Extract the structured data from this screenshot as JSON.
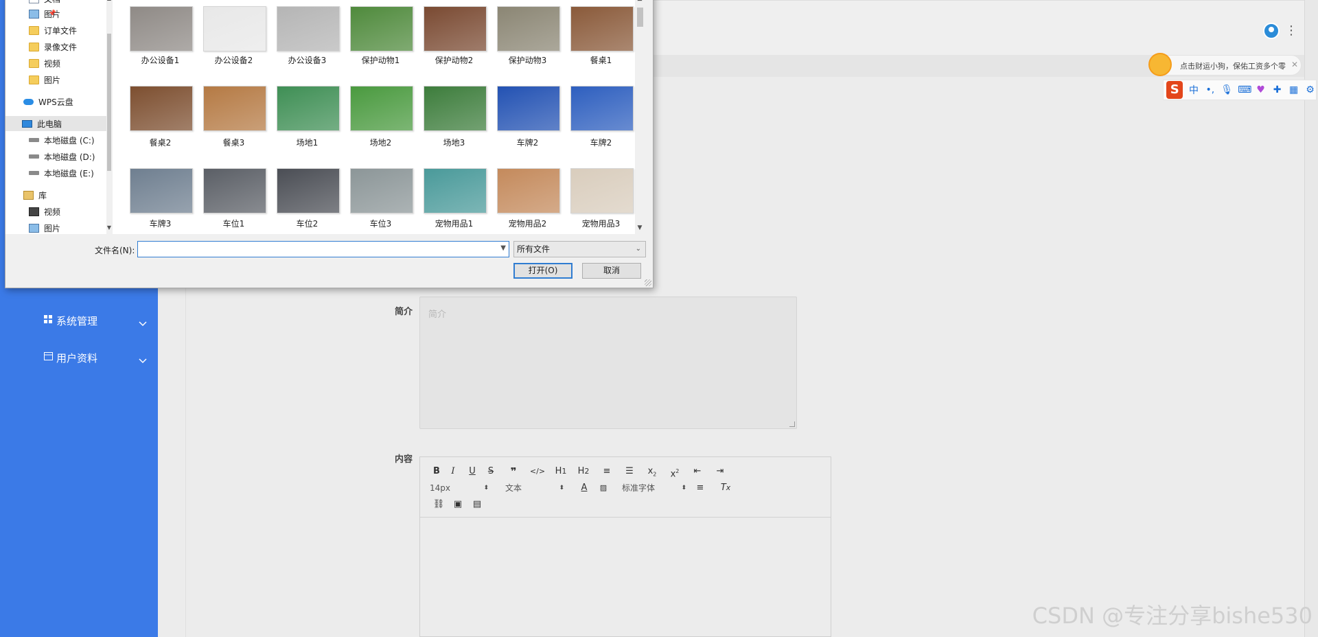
{
  "sidebar": {
    "items": [
      {
        "label": "系统管理",
        "icon": "grid-icon"
      },
      {
        "label": "用户资料",
        "icon": "card-icon"
      }
    ]
  },
  "form": {
    "intro_label": "简介",
    "intro_placeholder": "简介",
    "content_label": "内容"
  },
  "editor": {
    "font_size": "14px",
    "block_type": "文本",
    "font_family": "标准字体",
    "buttons": [
      "B",
      "I",
      "U",
      "S",
      "❞",
      "</>",
      "H1",
      "H2",
      "ol",
      "ul",
      "x₂",
      "x²",
      "outdent",
      "indent",
      "font-color",
      "bg-color",
      "align",
      "clear-format",
      "link",
      "image",
      "video"
    ]
  },
  "ime": {
    "tip_text": "点击财运小狗，保佑工资多个零",
    "mode_label": "中",
    "punct_label": "•,"
  },
  "watermark": "CSDN @专注分享bishe530",
  "dialog": {
    "nav": [
      {
        "label": "文档",
        "icon": "document-icon",
        "pinned": true
      },
      {
        "label": "图片",
        "icon": "pictures-icon",
        "pinned": true
      },
      {
        "label": "订单文件",
        "icon": "folder-icon"
      },
      {
        "label": "录像文件",
        "icon": "folder-icon"
      },
      {
        "label": "视频",
        "icon": "folder-icon"
      },
      {
        "label": "图片",
        "icon": "folder-icon"
      },
      {
        "label": "WPS云盘",
        "icon": "cloud-icon"
      },
      {
        "label": "此电脑",
        "icon": "computer-icon"
      },
      {
        "label": "本地磁盘 (C:)",
        "icon": "drive-icon"
      },
      {
        "label": "本地磁盘 (D:)",
        "icon": "drive-icon"
      },
      {
        "label": "本地磁盘 (E:)",
        "icon": "drive-icon"
      },
      {
        "label": "库",
        "icon": "library-icon"
      },
      {
        "label": "视频",
        "icon": "video-icon"
      },
      {
        "label": "图片",
        "icon": "pictures-icon"
      }
    ],
    "files": [
      {
        "name": "办公设备1",
        "color": "#8f8a86"
      },
      {
        "name": "办公设备2",
        "color": "#e8e8e8"
      },
      {
        "name": "办公设备3",
        "color": "#b5b5b5"
      },
      {
        "name": "保护动物1",
        "color": "#4f8a3c"
      },
      {
        "name": "保护动物2",
        "color": "#7a4a32"
      },
      {
        "name": "保护动物3",
        "color": "#8b8674"
      },
      {
        "name": "餐桌1",
        "color": "#8a5a3a"
      },
      {
        "name": "餐桌2",
        "color": "#7d4f30"
      },
      {
        "name": "餐桌3",
        "color": "#b57a44"
      },
      {
        "name": "场地1",
        "color": "#3f8f55"
      },
      {
        "name": "场地2",
        "color": "#4a9a3f"
      },
      {
        "name": "场地3",
        "color": "#3d7d3c"
      },
      {
        "name": "车牌2",
        "color": "#2352b3"
      },
      {
        "name": "车牌2",
        "color": "#2e5fbf"
      },
      {
        "name": "车牌3",
        "color": "#6f7f90"
      },
      {
        "name": "车位1",
        "color": "#5b5f66"
      },
      {
        "name": "车位2",
        "color": "#4b4e55"
      },
      {
        "name": "车位3",
        "color": "#8c9698"
      },
      {
        "name": "宠物用品1",
        "color": "#4a9a9a"
      },
      {
        "name": "宠物用品2",
        "color": "#c48a5c"
      },
      {
        "name": "宠物用品3",
        "color": "#d9cdbd"
      }
    ],
    "filename_label": "文件名(N):",
    "filename_value": "",
    "filetype": "所有文件",
    "open_label": "打开(O)",
    "cancel_label": "取消"
  }
}
